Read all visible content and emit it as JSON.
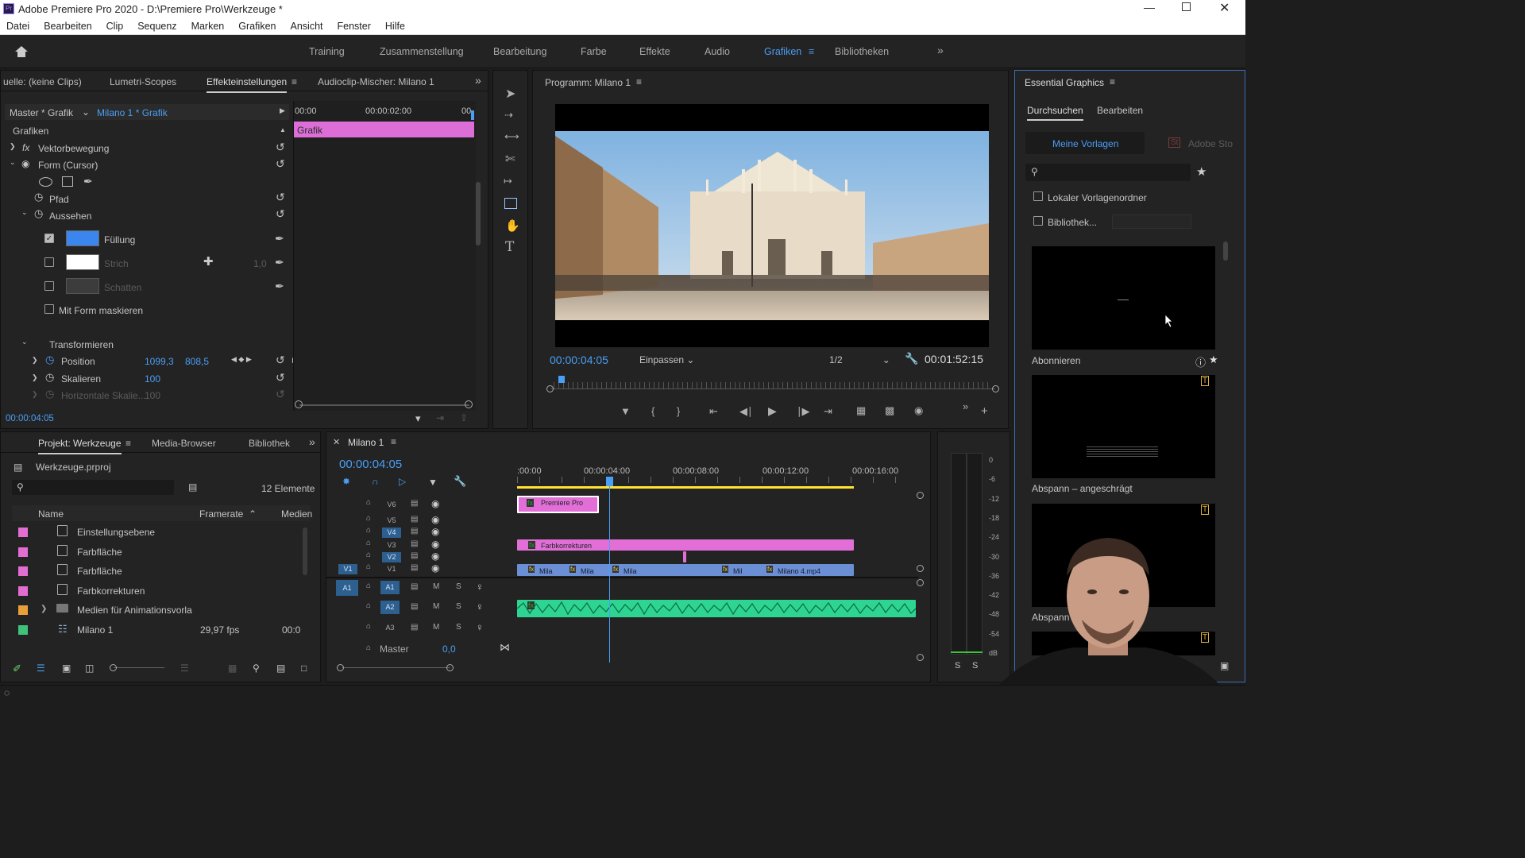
{
  "app": {
    "title": "Adobe Premiere Pro 2020 - D:\\Premiere Pro\\Werkzeuge *",
    "logo": "Pr"
  },
  "menu": [
    "Datei",
    "Bearbeiten",
    "Clip",
    "Sequenz",
    "Marken",
    "Grafiken",
    "Ansicht",
    "Fenster",
    "Hilfe"
  ],
  "workspaces": [
    "Training",
    "Zusammenstellung",
    "Bearbeitung",
    "Farbe",
    "Effekte",
    "Audio",
    "Grafiken",
    "Bibliotheken"
  ],
  "active_workspace": "Grafiken",
  "effects": {
    "tabs": [
      "uelle: (keine Clips)",
      "Lumetri-Scopes",
      "Effekteinstellungen",
      "Audioclip-Mischer: Milano 1"
    ],
    "master": "Master * Grafik",
    "seq": "Milano 1 * Grafik",
    "section": "Grafiken",
    "vektor": "Vektorbewegung",
    "form": "Form (Cursor)",
    "pfad": "Pfad",
    "aussehen": "Aussehen",
    "fill": "Füllung",
    "stroke": "Strich",
    "stroke_val": "1,0",
    "shadow": "Schatten",
    "mask": "Mit Form maskieren",
    "transform": "Transformieren",
    "position": "Position",
    "pos_x": "1099,3",
    "pos_y": "808,5",
    "scale": "Skalieren",
    "scale_val": "100",
    "hscale": "Horizontale Skalie...",
    "hscale_val": "100",
    "ruler": [
      "00:00",
      "00:00:02:00",
      "00"
    ],
    "clip": "Grafik",
    "timecode": "00:00:04:05",
    "fill_color": "#3b86ee"
  },
  "program": {
    "title": "Programm: Milano 1",
    "tc": "00:00:04:05",
    "fit": "Einpassen",
    "res": "1/2",
    "duration": "00:01:52:15"
  },
  "project": {
    "tabs": [
      "Projekt: Werkzeuge",
      "Media-Browser",
      "Bibliothek"
    ],
    "file": "Werkzeuge.prproj",
    "count": "12 Elemente",
    "cols": [
      "Name",
      "Framerate",
      "Medien"
    ],
    "items": [
      {
        "name": "Einstellungsebene",
        "color": "#e36ed3",
        "rate": "",
        "media": ""
      },
      {
        "name": "Farbfläche",
        "color": "#e36ed3",
        "rate": "",
        "media": ""
      },
      {
        "name": "Farbfläche",
        "color": "#e36ed3",
        "rate": "",
        "media": ""
      },
      {
        "name": "Farbkorrekturen",
        "color": "#e36ed3",
        "rate": "",
        "media": ""
      },
      {
        "name": "Medien für Animationsvorla",
        "color": "#e8a13a",
        "rate": "",
        "media": ""
      },
      {
        "name": "Milano 1",
        "color": "#3fc27a",
        "rate": "29,97 fps",
        "media": "00:0"
      }
    ]
  },
  "timeline": {
    "name": "Milano 1",
    "tc": "00:00:04:05",
    "ruler": [
      ":00:00",
      "00:00:04:00",
      "00:00:08:00",
      "00:00:12:00",
      "00:00:16:00"
    ],
    "video_tracks": [
      "V6",
      "V5",
      "V4",
      "V3",
      "V2",
      "V1"
    ],
    "audio_tracks": [
      "A1",
      "A2",
      "A3"
    ],
    "master": "Master",
    "master_val": "0,0",
    "clip_premiere": "Premiere Pro",
    "clip_farb": "Farbkorrekturen",
    "v1_clips": [
      "Mila",
      "Mila",
      "Mila",
      "Mil",
      "Milano 4.mp4"
    ],
    "M": "M",
    "S": "S"
  },
  "meter": {
    "scale": [
      "0",
      "-6",
      "-12",
      "-18",
      "-24",
      "-30",
      "-36",
      "-42",
      "-48",
      "-54",
      "dB"
    ],
    "s": "S"
  },
  "eg": {
    "title": "Essential Graphics",
    "tabs": [
      "Durchsuchen",
      "Bearbeiten"
    ],
    "my_templates": "Meine Vorlagen",
    "adobe_stock": "Adobe Sto",
    "local": "Lokaler Vorlagenordner",
    "library": "Bibliothek...",
    "templates": [
      "Abonnieren",
      "Abspann – angeschrägt",
      "Abspann – fe"
    ]
  }
}
